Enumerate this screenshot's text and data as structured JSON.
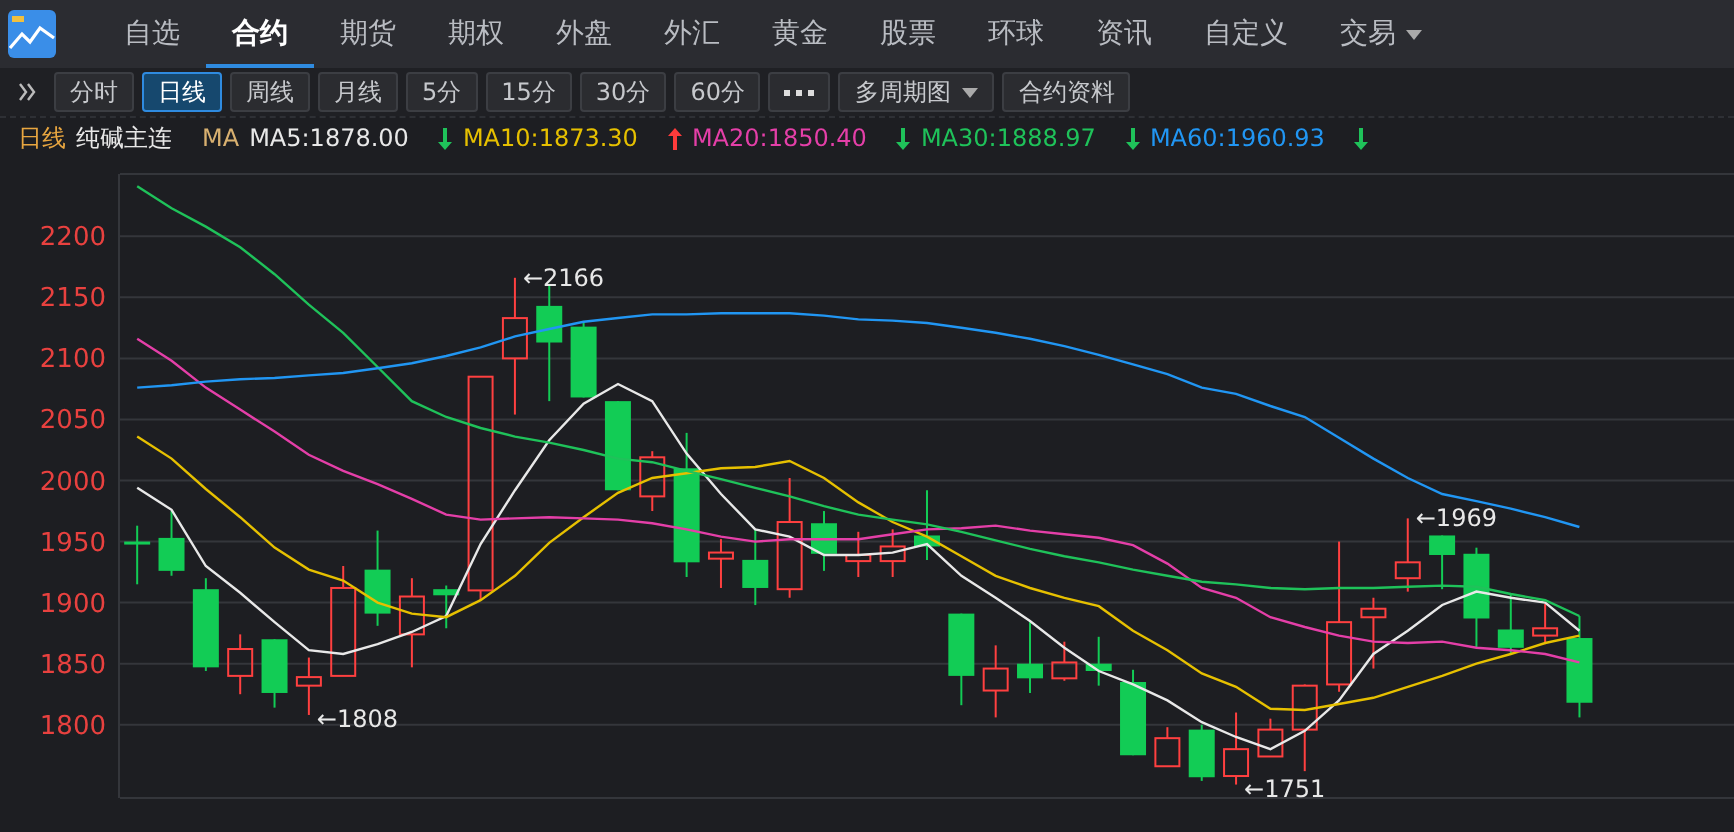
{
  "nav": {
    "tabs": [
      {
        "label": "自选",
        "selected": false,
        "kind": "tab"
      },
      {
        "label": "合约",
        "selected": true,
        "kind": "tab"
      },
      {
        "label": "期货",
        "selected": false,
        "kind": "tab"
      },
      {
        "label": "期权",
        "selected": false,
        "kind": "tab"
      },
      {
        "label": "外盘",
        "selected": false,
        "kind": "tab"
      },
      {
        "label": "外汇",
        "selected": false,
        "kind": "tab"
      },
      {
        "label": "黄金",
        "selected": false,
        "kind": "tab"
      },
      {
        "label": "股票",
        "selected": false,
        "kind": "tab"
      },
      {
        "label": "环球",
        "selected": false,
        "kind": "tab"
      },
      {
        "label": "资讯",
        "selected": false,
        "kind": "tab"
      },
      {
        "label": "自定义",
        "selected": false,
        "kind": "tab"
      },
      {
        "label": "交易",
        "selected": false,
        "kind": "menu"
      }
    ]
  },
  "toolbar": {
    "buttons": [
      {
        "label": "分时",
        "selected": false,
        "kind": "text"
      },
      {
        "label": "日线",
        "selected": true,
        "kind": "text"
      },
      {
        "label": "周线",
        "selected": false,
        "kind": "text"
      },
      {
        "label": "月线",
        "selected": false,
        "kind": "text"
      },
      {
        "label": "5分",
        "selected": false,
        "kind": "text"
      },
      {
        "label": "15分",
        "selected": false,
        "kind": "text"
      },
      {
        "label": "30分",
        "selected": false,
        "kind": "text"
      },
      {
        "label": "60分",
        "selected": false,
        "kind": "text"
      },
      {
        "selected": false,
        "kind": "more"
      },
      {
        "label": "多周期图",
        "selected": false,
        "kind": "menu"
      },
      {
        "label": "合约资料",
        "selected": false,
        "kind": "text"
      }
    ]
  },
  "info": {
    "period": "日线",
    "symbol": "纯碱主连",
    "ma_label": "MA",
    "indicators": [
      {
        "text": "MA5:1878.00",
        "color": "#e8e8e8",
        "kind": "plain"
      },
      {
        "text": "MA10:1873.30",
        "color": "#e6c000",
        "kind": "down"
      },
      {
        "text": "MA20:1850.40",
        "color": "#e43fa8",
        "kind": "up"
      },
      {
        "text": "MA30:1888.97",
        "color": "#1fc25a",
        "kind": "down"
      },
      {
        "text": "MA60:1960.93",
        "color": "#2196f3",
        "kind": "down"
      },
      {
        "kind": "down"
      }
    ]
  },
  "chart": {
    "chart_data": {
      "type": "candlestick",
      "grid": true,
      "categories": [
        null,
        null,
        null,
        null,
        null,
        null,
        null,
        null,
        null,
        null,
        null,
        null,
        null,
        null,
        null,
        null,
        null,
        null,
        null,
        null,
        null,
        null,
        null,
        null,
        null,
        null,
        null,
        null,
        null,
        null,
        null,
        null,
        null,
        null,
        null,
        null,
        null,
        null,
        null,
        null,
        null,
        null,
        null,
        null,
        null,
        null,
        null
      ],
      "ylim": [
        1740,
        2251
      ],
      "yticks": [
        1800,
        1850,
        1900,
        1950,
        2000,
        2050,
        2100,
        2150,
        2200
      ],
      "series": [
        {
          "type": "line",
          "color": "#e8e8e8",
          "values": [
            1994,
            1976,
            1930,
            1908,
            1884,
            1861,
            1858,
            1866,
            1876,
            1889,
            1948,
            1992,
            2033,
            2063,
            2079,
            2065,
            2022,
            1989,
            1960,
            1954,
            1939,
            1939,
            1941,
            1948,
            1922,
            1904,
            1885,
            1863,
            1844,
            1833,
            1820,
            1802,
            1790,
            1780,
            1795,
            1820,
            1858,
            1877,
            1898,
            1909,
            1904,
            1900,
            1877,
            null,
            null,
            null,
            null
          ]
        },
        {
          "type": "line",
          "color": "#e6c000",
          "values": [
            2036,
            2018,
            1993,
            1970,
            1945,
            1927,
            1918,
            1900,
            1891,
            1888,
            1902,
            1922,
            1949,
            1970,
            1990,
            2002,
            2006,
            2010,
            2011,
            2016,
            2002,
            1982,
            1966,
            1954,
            1938,
            1922,
            1912,
            1904,
            1897,
            1877,
            1861,
            1842,
            1831,
            1813,
            1812,
            1817,
            1822,
            1831,
            1840,
            1850,
            1858,
            1867,
            1873,
            null,
            null,
            null,
            null
          ]
        },
        {
          "type": "line",
          "color": "#e43fa8",
          "values": [
            2116,
            2098,
            2076,
            2058,
            2040,
            2021,
            2008,
            1997,
            1985,
            1972,
            1968,
            1969,
            1970,
            1969,
            1968,
            1965,
            1960,
            1954,
            1950,
            1952,
            1952,
            1952,
            1956,
            1960,
            1961,
            1963,
            1959,
            1956,
            1953,
            1947,
            1932,
            1912,
            1904,
            1888,
            1880,
            1873,
            1868,
            1867,
            1868,
            1863,
            1861,
            1858,
            1851,
            null,
            null,
            null,
            null
          ]
        },
        {
          "type": "line",
          "color": "#1fc25a",
          "values": [
            2241,
            2223,
            2208,
            2191,
            2169,
            2144,
            2121,
            2093,
            2065,
            2052,
            2043,
            2036,
            2031,
            2025,
            2018,
            2015,
            2008,
            2001,
            1994,
            1987,
            1979,
            1972,
            1968,
            1964,
            1958,
            1951,
            1944,
            1938,
            1933,
            1927,
            1922,
            1917,
            1915,
            1912,
            1911,
            1912,
            1912,
            1913,
            1914,
            1913,
            1907,
            1902,
            1889,
            null,
            null,
            null,
            null
          ]
        },
        {
          "type": "line",
          "color": "#2196f3",
          "values": [
            2076,
            2078,
            2081,
            2083,
            2084,
            2086,
            2088,
            2092,
            2096,
            2102,
            2109,
            2118,
            2124,
            2130,
            2133,
            2136,
            2136,
            2137,
            2137,
            2137,
            2135,
            2132,
            2131,
            2129,
            2125,
            2121,
            2116,
            2110,
            2103,
            2095,
            2087,
            2076,
            2071,
            2061,
            2052,
            2035,
            2018,
            2002,
            1989,
            1983,
            1977,
            1970,
            1962,
            null,
            null,
            null,
            null
          ]
        }
      ],
      "ohlc": [
        [
          1950,
          1963,
          1915,
          1948
        ],
        [
          1953,
          1975,
          1922,
          1926
        ],
        [
          1911,
          1920,
          1844,
          1847
        ],
        [
          1840,
          1874,
          1825,
          1862
        ],
        [
          1870,
          1870,
          1814,
          1826
        ],
        [
          1832,
          1855,
          1808,
          1839
        ],
        [
          1840,
          1930,
          1840,
          1912
        ],
        [
          1927,
          1959,
          1881,
          1891
        ],
        [
          1874,
          1920,
          1847,
          1905
        ],
        [
          1911,
          1914,
          1879,
          1906
        ],
        [
          1910,
          2085,
          1902,
          2085
        ],
        [
          2100,
          2166,
          2054,
          2133
        ],
        [
          2143,
          2161,
          2065,
          2113
        ],
        [
          2126,
          2130,
          2068,
          2068
        ],
        [
          2065,
          2065,
          1992,
          1992
        ],
        [
          1987,
          2024,
          1975,
          2019
        ],
        [
          2010,
          2039,
          1921,
          1933
        ],
        [
          1936,
          1952,
          1912,
          1941
        ],
        [
          1935,
          1960,
          1898,
          1912
        ],
        [
          1911,
          2002,
          1904,
          1966
        ],
        [
          1965,
          1975,
          1926,
          1940
        ],
        [
          1934,
          1958,
          1921,
          1939
        ],
        [
          1934,
          1960,
          1921,
          1946
        ],
        [
          1955,
          1992,
          1935,
          1946
        ],
        [
          1891,
          1891,
          1816,
          1840
        ],
        [
          1828,
          1865,
          1806,
          1846
        ],
        [
          1850,
          1884,
          1826,
          1838
        ],
        [
          1838,
          1868,
          1836,
          1851
        ],
        [
          1850,
          1872,
          1832,
          1844
        ],
        [
          1835,
          1845,
          1775,
          1775
        ],
        [
          1766,
          1798,
          1766,
          1789
        ],
        [
          1796,
          1800,
          1754,
          1757
        ],
        [
          1758,
          1810,
          1751,
          1780
        ],
        [
          1774,
          1805,
          1774,
          1796
        ],
        [
          1796,
          1833,
          1762,
          1832
        ],
        [
          1833,
          1950,
          1827,
          1884
        ],
        [
          1888,
          1904,
          1846,
          1895
        ],
        [
          1920,
          1969,
          1909,
          1933
        ],
        [
          1955,
          1955,
          1911,
          1939
        ],
        [
          1940,
          1945,
          1863,
          1887
        ],
        [
          1878,
          1907,
          1858,
          1863
        ],
        [
          1873,
          1899,
          1866,
          1879
        ],
        [
          1871,
          1889,
          1806,
          1818
        ],
        null,
        null,
        null,
        null
      ],
      "annotations": [
        "←2166",
        "←1808",
        "←1751",
        "←1969"
      ]
    }
  }
}
